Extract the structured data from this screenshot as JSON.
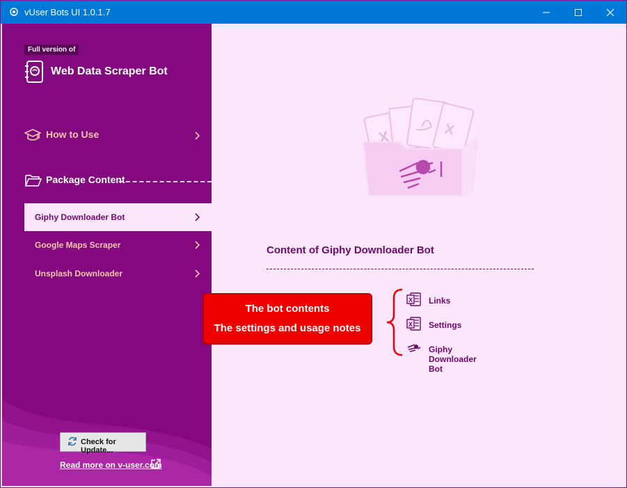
{
  "window": {
    "title": "vUser Bots UI 1.0.1.7"
  },
  "sidebar": {
    "badge": "Full version of",
    "app_title": "Web Data Scraper Bot",
    "how_to_use": "How to Use",
    "package_content": "Package Content",
    "bots": [
      {
        "label": "Giphy Downloader Bot",
        "active": true
      },
      {
        "label": "Google Maps Scraper",
        "active": false
      },
      {
        "label": "Unsplash Downloader",
        "active": false
      }
    ],
    "update_button": "Check for Update...",
    "read_more": "Read more on v-user.com"
  },
  "main": {
    "content_title": "Content of Giphy Downloader Bot",
    "files": [
      {
        "label": "Links",
        "icon": "excel-icon"
      },
      {
        "label": "Settings",
        "icon": "excel-icon"
      },
      {
        "label": "Giphy Downloader Bot",
        "icon": "robot-hand-icon"
      }
    ]
  },
  "callout": {
    "line1": "The bot contents",
    "line2": "The settings and usage notes"
  },
  "colors": {
    "titlebar": "#0078d7",
    "sidebar": "#83097f",
    "main_bg": "#fbe6fb",
    "accent_text": "#6d0a6a",
    "callout": "#ee0000"
  }
}
